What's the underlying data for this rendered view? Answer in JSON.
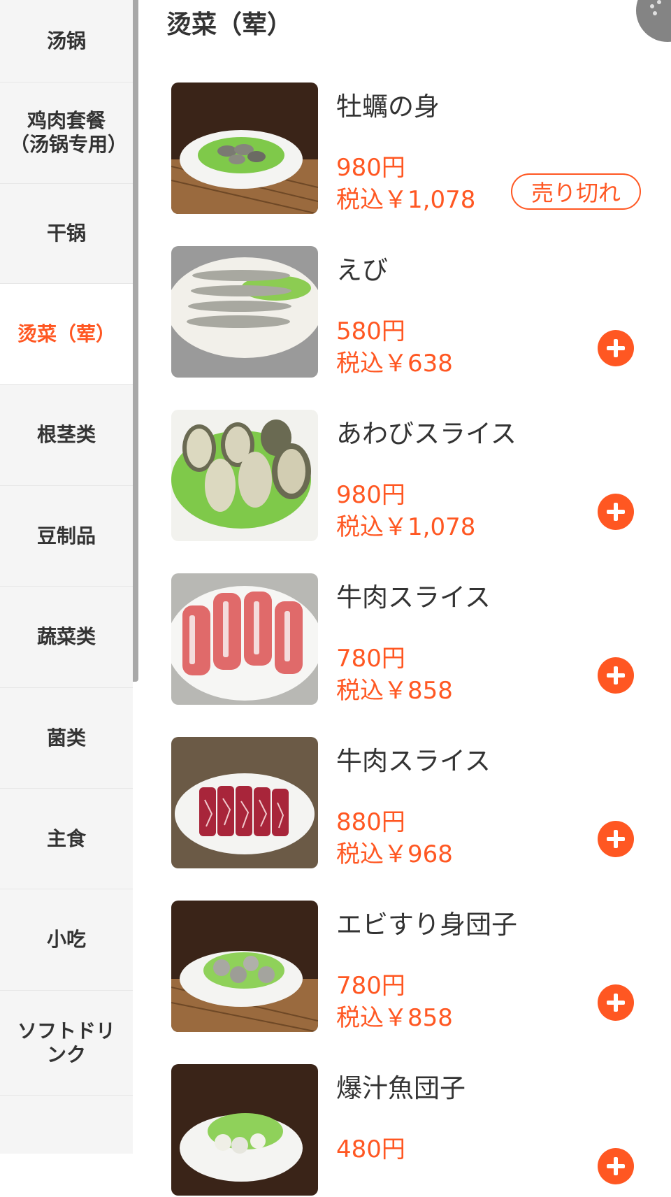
{
  "sidebar": {
    "items": [
      {
        "label": "汤锅",
        "active": false
      },
      {
        "label": "鸡肉套餐（汤锅专用）",
        "active": false
      },
      {
        "label": "干锅",
        "active": false
      },
      {
        "label": "烫菜（荤）",
        "active": true
      },
      {
        "label": "根茎类",
        "active": false
      },
      {
        "label": "豆制品",
        "active": false
      },
      {
        "label": "蔬菜类",
        "active": false
      },
      {
        "label": "菌类",
        "active": false
      },
      {
        "label": "主食",
        "active": false
      },
      {
        "label": "小吃",
        "active": false
      },
      {
        "label": "ソフトドリンク",
        "active": false
      }
    ]
  },
  "main": {
    "section_title": "烫菜（荤）",
    "items": [
      {
        "name": "牡蠣の身",
        "price": "980円",
        "tax_price": "税込￥1,078",
        "status": "売り切れ"
      },
      {
        "name": "えび",
        "price": "580円",
        "tax_price": "税込￥638"
      },
      {
        "name": "あわびスライス",
        "price": "980円",
        "tax_price": "税込￥1,078"
      },
      {
        "name": "牛肉スライス",
        "price": "780円",
        "tax_price": "税込￥858"
      },
      {
        "name": "牛肉スライス",
        "price": "880円",
        "tax_price": "税込￥968"
      },
      {
        "name": "エビすり身団子",
        "price": "780円",
        "tax_price": "税込￥858"
      },
      {
        "name": "爆汁魚団子",
        "price": "480円",
        "tax_price": ""
      }
    ]
  },
  "colors": {
    "accent": "#ff5722",
    "sidebar_bg": "#f5f5f5",
    "text": "#333333"
  },
  "icons": {
    "add": "plus-circle-icon"
  }
}
